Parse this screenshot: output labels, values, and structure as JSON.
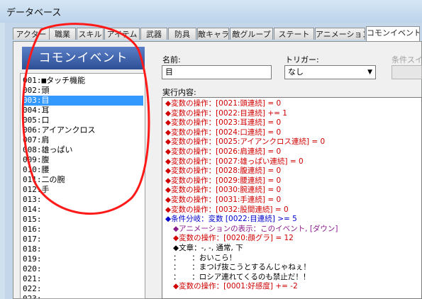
{
  "window": {
    "title": "データベース"
  },
  "tabs": [
    {
      "label": "アクター",
      "active": false
    },
    {
      "label": "職業",
      "active": false
    },
    {
      "label": "スキル",
      "active": false
    },
    {
      "label": "アイテム",
      "active": false
    },
    {
      "label": "武器",
      "active": false
    },
    {
      "label": "防具",
      "active": false
    },
    {
      "label": "敵キャラ",
      "active": false
    },
    {
      "label": "敵グループ",
      "active": false
    },
    {
      "label": "ステート",
      "active": false
    },
    {
      "label": "アニメーション",
      "active": false
    },
    {
      "label": "コモンイベント",
      "active": true
    }
  ],
  "list": {
    "header": "コモンイベント",
    "items": [
      {
        "label": "001:■タッチ機能"
      },
      {
        "label": "002:頭"
      },
      {
        "label": "003:目",
        "selected": true
      },
      {
        "label": "004:耳"
      },
      {
        "label": "005:口"
      },
      {
        "label": "006:アイアンクロス"
      },
      {
        "label": "007:肩"
      },
      {
        "label": "008:雄っぱい"
      },
      {
        "label": "009:腹"
      },
      {
        "label": "010:腰"
      },
      {
        "label": "011:二の腕"
      },
      {
        "label": "012:手"
      },
      {
        "label": "013:"
      },
      {
        "label": "014:"
      },
      {
        "label": "015:"
      },
      {
        "label": "016:"
      },
      {
        "label": "017:"
      },
      {
        "label": "018:"
      },
      {
        "label": "019:"
      },
      {
        "label": "020:"
      },
      {
        "label": "021:"
      },
      {
        "label": "022:"
      },
      {
        "label": "023:"
      }
    ]
  },
  "form": {
    "name_label": "名前:",
    "name_value": "目",
    "trigger_label": "トリガー:",
    "trigger_value": "なし",
    "switch_label": "条件スイッ",
    "contents_label": "実行内容:"
  },
  "commands": [
    {
      "text": "◆変数の操作：[0021:頭連続] = 0",
      "color": "red"
    },
    {
      "text": "◆変数の操作：[0022:目連続] += 1",
      "color": "red"
    },
    {
      "text": "◆変数の操作：[0023:耳連続] = 0",
      "color": "red"
    },
    {
      "text": "◆変数の操作：[0024:口連続] = 0",
      "color": "red"
    },
    {
      "text": "◆変数の操作：[0025:アイアンクロス連続] = 0",
      "color": "red"
    },
    {
      "text": "◆変数の操作：[0026:肩連続] = 0",
      "color": "red"
    },
    {
      "text": "◆変数の操作：[0027:雄っぱい連続] = 0",
      "color": "red"
    },
    {
      "text": "◆変数の操作：[0028:腹連続] = 0",
      "color": "red"
    },
    {
      "text": "◆変数の操作：[0029:腰連続] = 0",
      "color": "red"
    },
    {
      "text": "◆変数の操作：[0030:腕連続] = 0",
      "color": "red"
    },
    {
      "text": "◆変数の操作：[0031:手連続] = 0",
      "color": "red"
    },
    {
      "text": "◆変数の操作：[0032:股間連続] = 0",
      "color": "red"
    },
    {
      "text": "◆条件分岐：変数 [0022:目連続] >= 5",
      "color": "blue"
    },
    {
      "text": "◆アニメーションの表示：このイベント, [ダウン]",
      "color": "purple",
      "indent": 1
    },
    {
      "text": "◆変数の操作：[0020:顔グラ] = 12",
      "color": "red",
      "indent": 1
    },
    {
      "text": "◆文章：-, -, 通常, 下",
      "color": "black",
      "indent": 1
    },
    {
      "text": "：　　：おいこら！",
      "color": "black",
      "indent": 1
    },
    {
      "text": "：　　：まつげ抜こうとするんじゃねぇ！",
      "color": "black",
      "indent": 1
    },
    {
      "text": "：　　：ロシア連れてくるのも禁止だ！！",
      "color": "black",
      "indent": 1
    },
    {
      "text": "◆変数の操作：[0001:好感度] += -2",
      "color": "red",
      "indent": 1
    }
  ],
  "colors": {
    "red": "#d00000",
    "blue": "#0000cc",
    "purple": "#8a1a8a",
    "black": "#000000",
    "annotation": "#ff1a1a",
    "selection": "#3399ff"
  }
}
